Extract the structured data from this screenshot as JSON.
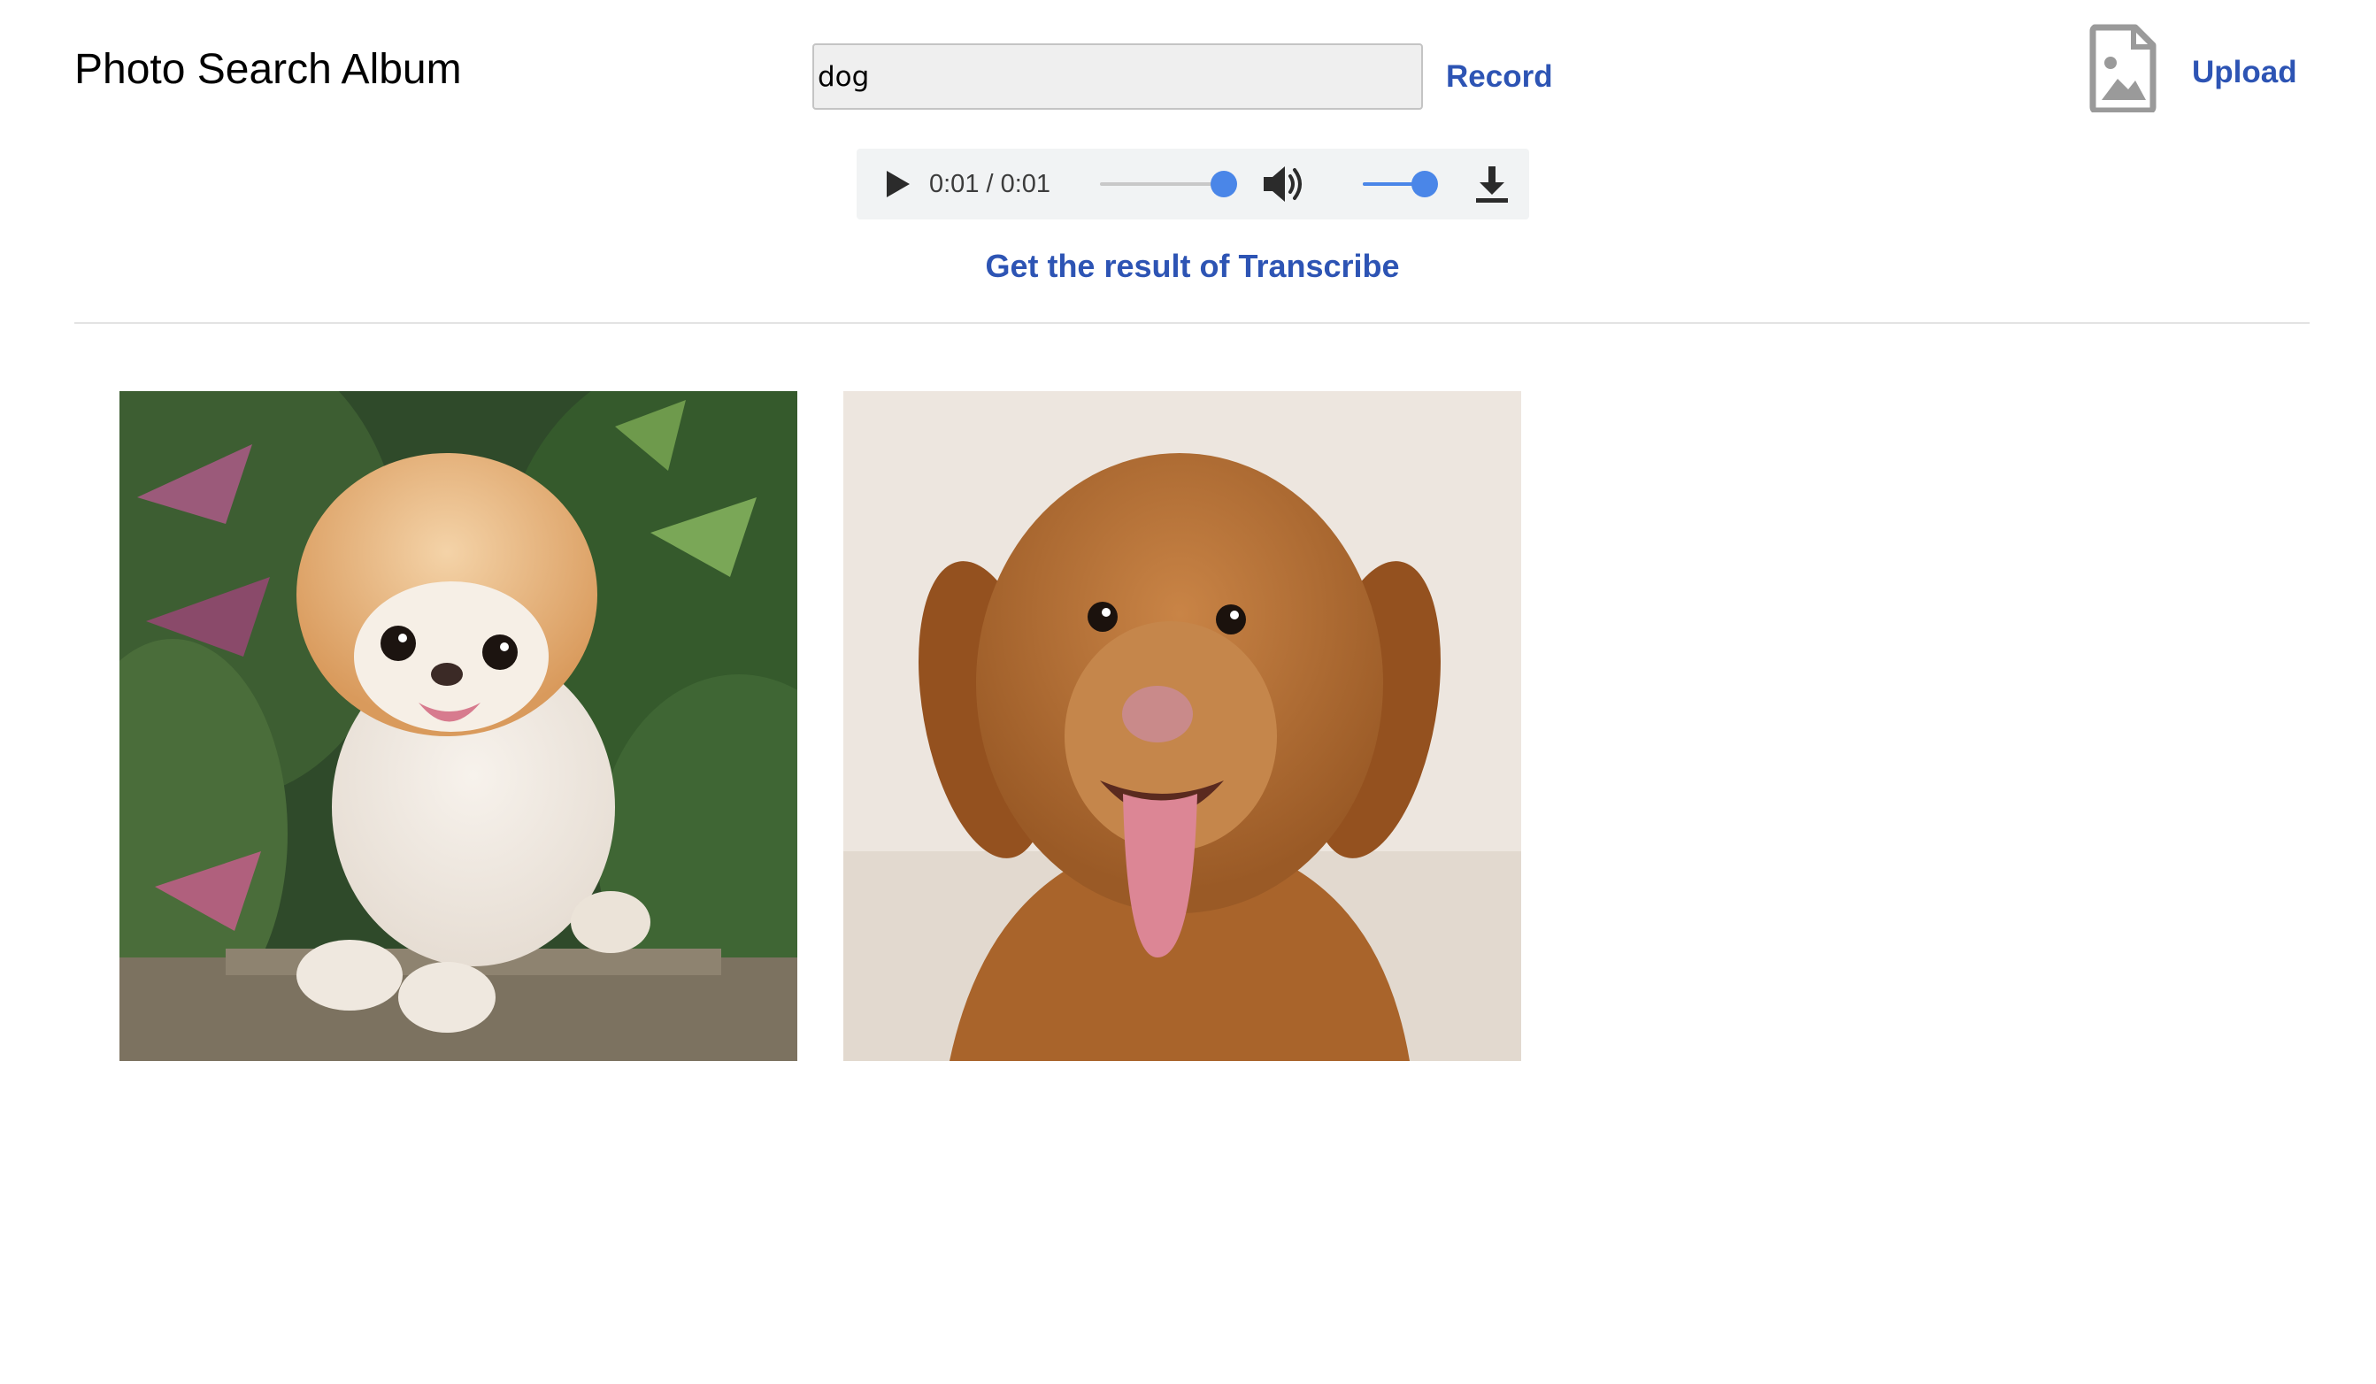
{
  "header": {
    "title": "Photo Search Album",
    "search_value": "dog",
    "record_label": "Record",
    "upload_label": "Upload",
    "upload_icon": "image-file-icon"
  },
  "audio_player": {
    "time_display": "0:01 / 0:01",
    "progress_fraction": 1.0,
    "volume_fraction": 1.0,
    "icons": [
      "play-icon",
      "volume-icon",
      "download-icon"
    ],
    "accent_color": "#4a86e8"
  },
  "transcribe": {
    "label": "Get the result of Transcribe"
  },
  "results": {
    "photos": [
      "pomeranian-dog-photo",
      "retriever-dog-photo"
    ]
  },
  "colors": {
    "link": "#2d54b4",
    "input_bg": "#efefef"
  }
}
